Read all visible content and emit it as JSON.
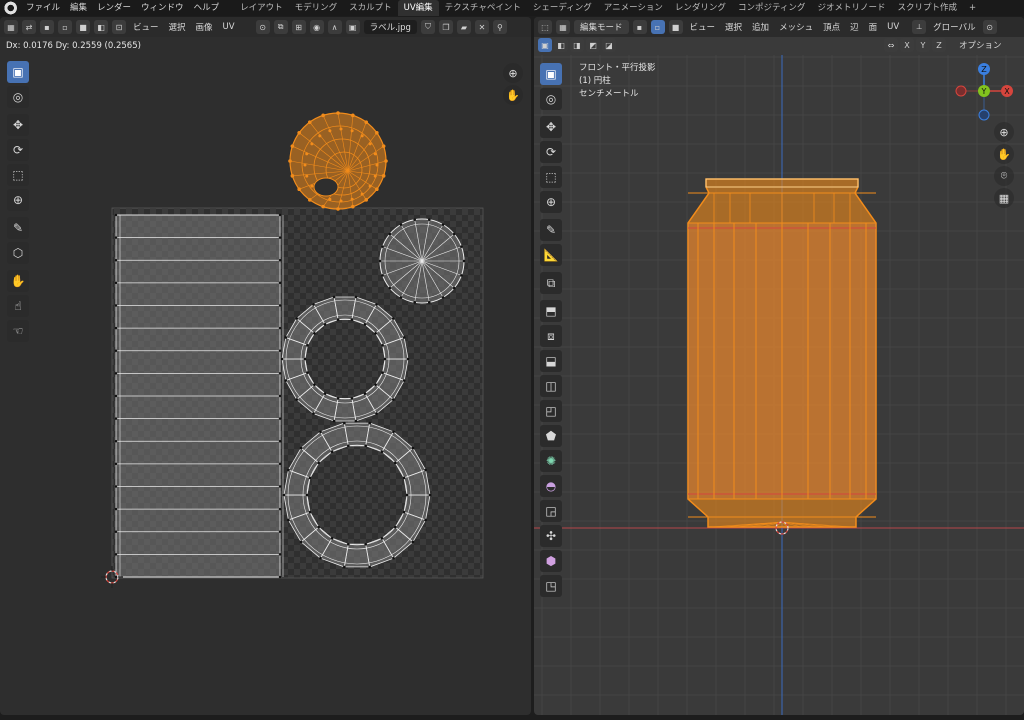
{
  "topbar": {
    "menus": [
      "ファイル",
      "編集",
      "レンダー",
      "ウィンドウ",
      "ヘルプ"
    ],
    "workspaces": [
      "レイアウト",
      "モデリング",
      "スカルプト",
      "UV編集",
      "テクスチャペイント",
      "シェーディング",
      "アニメーション",
      "レンダリング",
      "コンポジティング",
      "ジオメトリノード",
      "スクリプト作成"
    ],
    "active_workspace": "UV編集",
    "add_tab": "+"
  },
  "uv_editor": {
    "menus": [
      "ビュー",
      "選択",
      "画像",
      "UV"
    ],
    "image_name": "ラベル.jpg",
    "status_text": "Dx: 0.0176   Dy: 0.2559 (0.2565)"
  },
  "viewport": {
    "mode": "編集モード",
    "menus": [
      "ビュー",
      "選択",
      "追加",
      "メッシュ",
      "頂点",
      "辺",
      "面",
      "UV"
    ],
    "transform_orientation": "グローバル",
    "options_label": "オプション",
    "axis_buttons": [
      "X",
      "Y",
      "Z"
    ],
    "overlay_lines": [
      "フロント・平行投影",
      "(1) 円柱",
      "センチメートル"
    ],
    "gizmo_labels": {
      "x": "X",
      "y": "Y",
      "z": "Z"
    }
  },
  "icons": {
    "select": "▣",
    "cursor": "◎",
    "move": "✥",
    "rotate": "⟳",
    "scale": "⬚",
    "transform": "⊕",
    "annotate": "✎",
    "rip": "⬡",
    "grab": "✋",
    "relax": "☝",
    "pinch": "☜",
    "zoom": "⊕",
    "pan": "✋",
    "camera": "⌾",
    "grid": "▦"
  },
  "colors": {
    "accent": "#4772b3",
    "selection_orange": "#f28c1b",
    "x_axis": "#d6453d",
    "y_axis": "#82c31e",
    "z_axis": "#3a7fe0"
  }
}
